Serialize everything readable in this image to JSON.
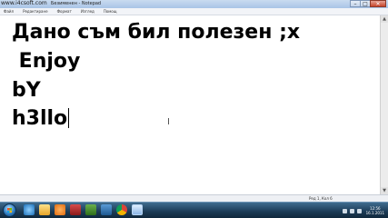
{
  "watermark": "www.i4csoft.com",
  "window": {
    "title": "Безименен - Notepad"
  },
  "controls": {
    "minimize": "–",
    "maximize": "□",
    "close": "✕"
  },
  "menu": {
    "items": [
      {
        "label": "Файл"
      },
      {
        "label": "Редактиране"
      },
      {
        "label": "Формат"
      },
      {
        "label": "Изглед"
      },
      {
        "label": "Помощ"
      }
    ]
  },
  "editor": {
    "lines": [
      "Дано съм бил полезен ;x",
      " Enjoy",
      "bY",
      "h3llo"
    ]
  },
  "status": {
    "position": "Ред 1, Кол 6"
  },
  "scrollbar": {
    "up": "▲",
    "down": "▼"
  },
  "taskbar": {
    "icons": [
      "internet-explorer-icon",
      "folder-icon",
      "media-player-icon",
      "app-icon",
      "app-icon",
      "app-icon",
      "chrome-icon",
      "notepad-icon"
    ]
  },
  "clock": {
    "time": "12:56",
    "date": "16.1.2011"
  }
}
